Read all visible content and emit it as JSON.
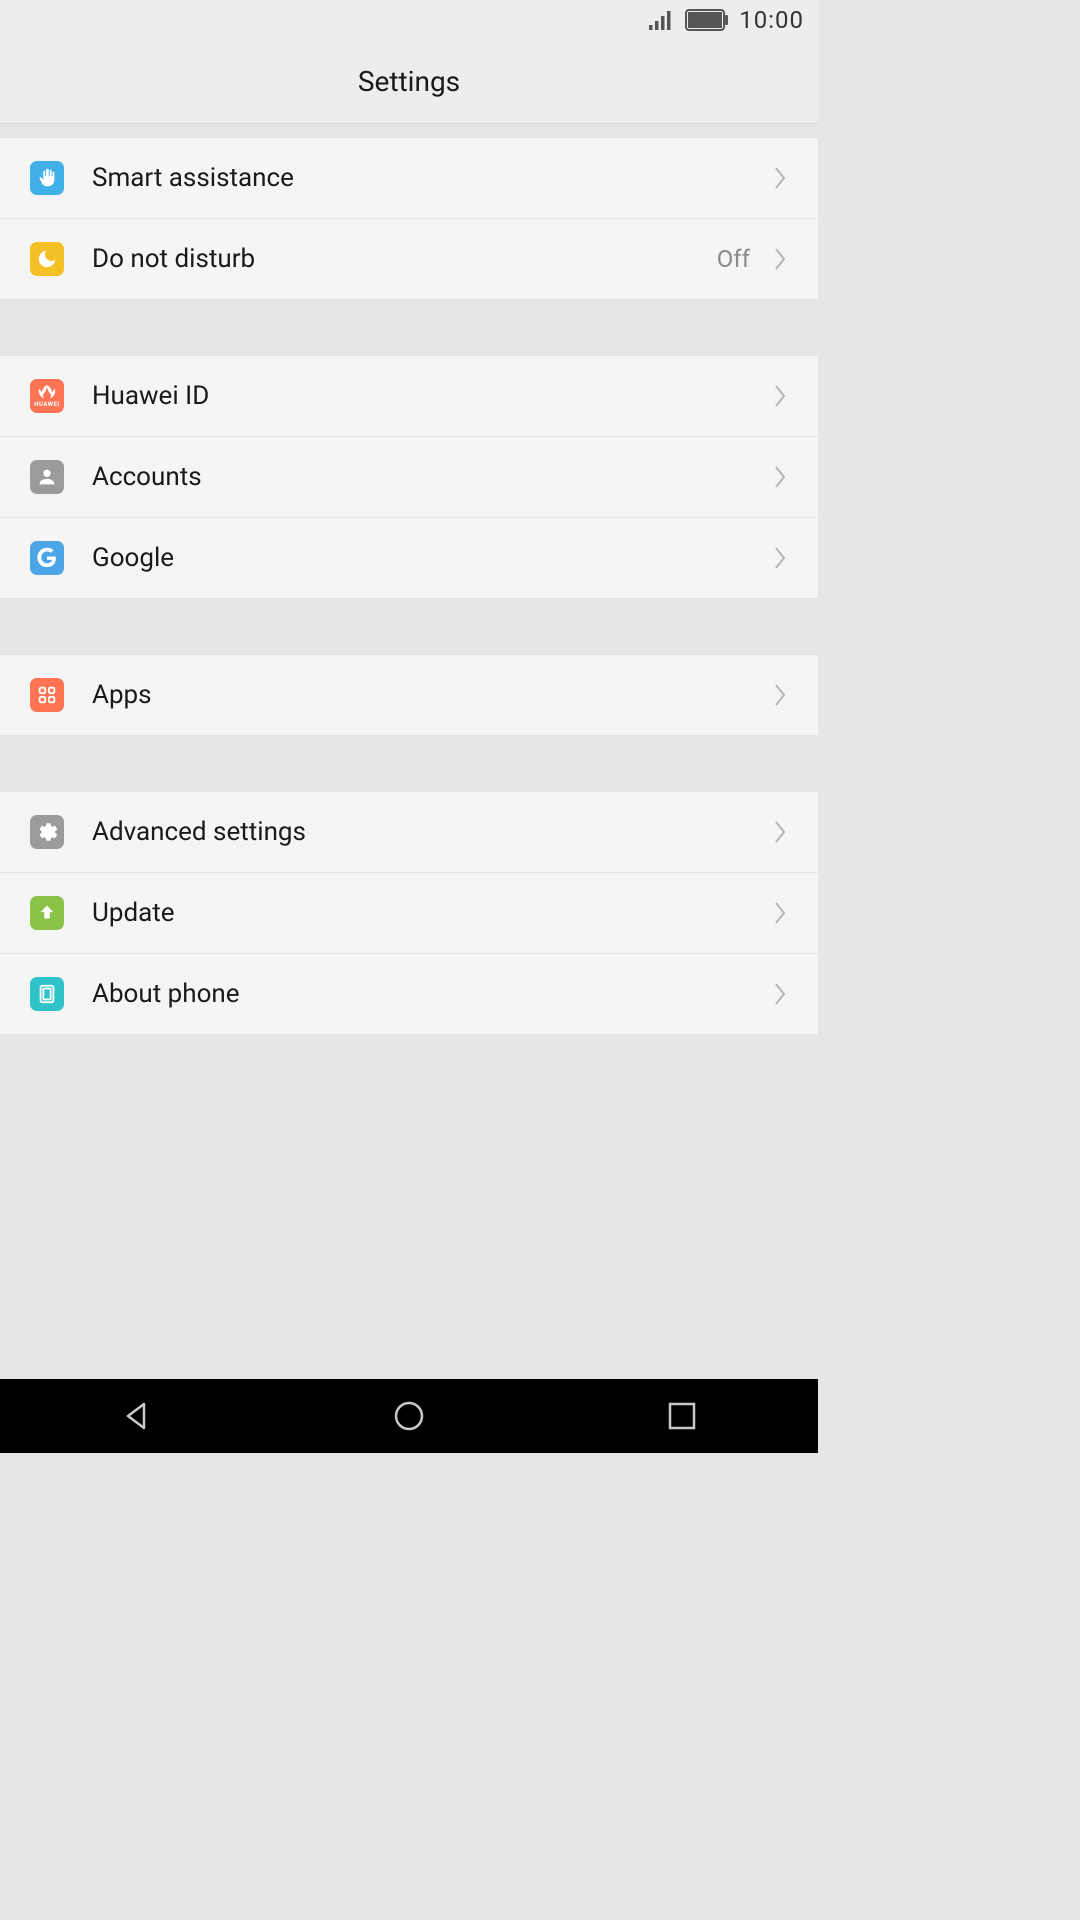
{
  "statusbar": {
    "time": "10:00"
  },
  "header": {
    "title": "Settings"
  },
  "items": {
    "smart_assistance": {
      "label": "Smart assistance"
    },
    "do_not_disturb": {
      "label": "Do not disturb",
      "value": "Off"
    },
    "huawei_id": {
      "label": "Huawei ID"
    },
    "accounts": {
      "label": "Accounts"
    },
    "google": {
      "label": "Google"
    },
    "apps": {
      "label": "Apps"
    },
    "advanced": {
      "label": "Advanced settings"
    },
    "update": {
      "label": "Update"
    },
    "about": {
      "label": "About phone"
    }
  },
  "iconLabels": {
    "huawei": "HUAWEI"
  }
}
